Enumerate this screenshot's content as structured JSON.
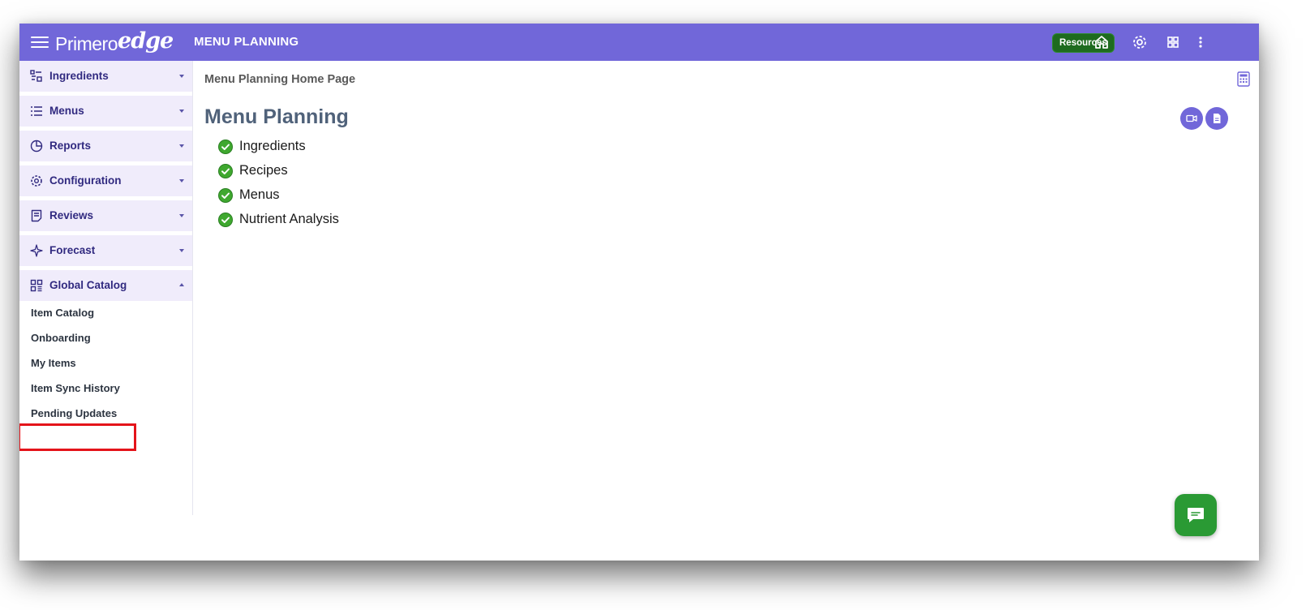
{
  "header": {
    "logo_primary": "Primero",
    "logo_secondary": "edge",
    "title": "MENU PLANNING",
    "resources_label": "Resources",
    "color": "#7167d9"
  },
  "sidebar": {
    "sections": [
      {
        "label": "Ingredients",
        "icon": "ingredients-icon",
        "expanded": false
      },
      {
        "label": "Menus",
        "icon": "list-icon",
        "expanded": false
      },
      {
        "label": "Reports",
        "icon": "pie-chart-icon",
        "expanded": false
      },
      {
        "label": "Configuration",
        "icon": "gear-icon",
        "expanded": false
      },
      {
        "label": "Reviews",
        "icon": "review-doc-icon",
        "expanded": false
      },
      {
        "label": "Forecast",
        "icon": "sparkle-icon",
        "expanded": false
      },
      {
        "label": "Global Catalog",
        "icon": "grid-icon",
        "expanded": true
      }
    ],
    "global_catalog_items": [
      {
        "label": "Item Catalog"
      },
      {
        "label": "Onboarding"
      },
      {
        "label": "My Items"
      },
      {
        "label": "Item Sync History"
      },
      {
        "label": "Pending Updates",
        "highlighted": true
      }
    ]
  },
  "main": {
    "breadcrumb": "Menu Planning Home Page",
    "title": "Menu Planning",
    "checklist": [
      {
        "label": "Ingredients"
      },
      {
        "label": "Recipes"
      },
      {
        "label": "Menus"
      },
      {
        "label": "Nutrient Analysis"
      }
    ]
  },
  "colors": {
    "accent": "#7167d9",
    "resources_bg": "#1e6b1f",
    "check_green": "#3fa82f",
    "chat_green": "#2a9a34",
    "highlight_red": "#e4141a"
  }
}
